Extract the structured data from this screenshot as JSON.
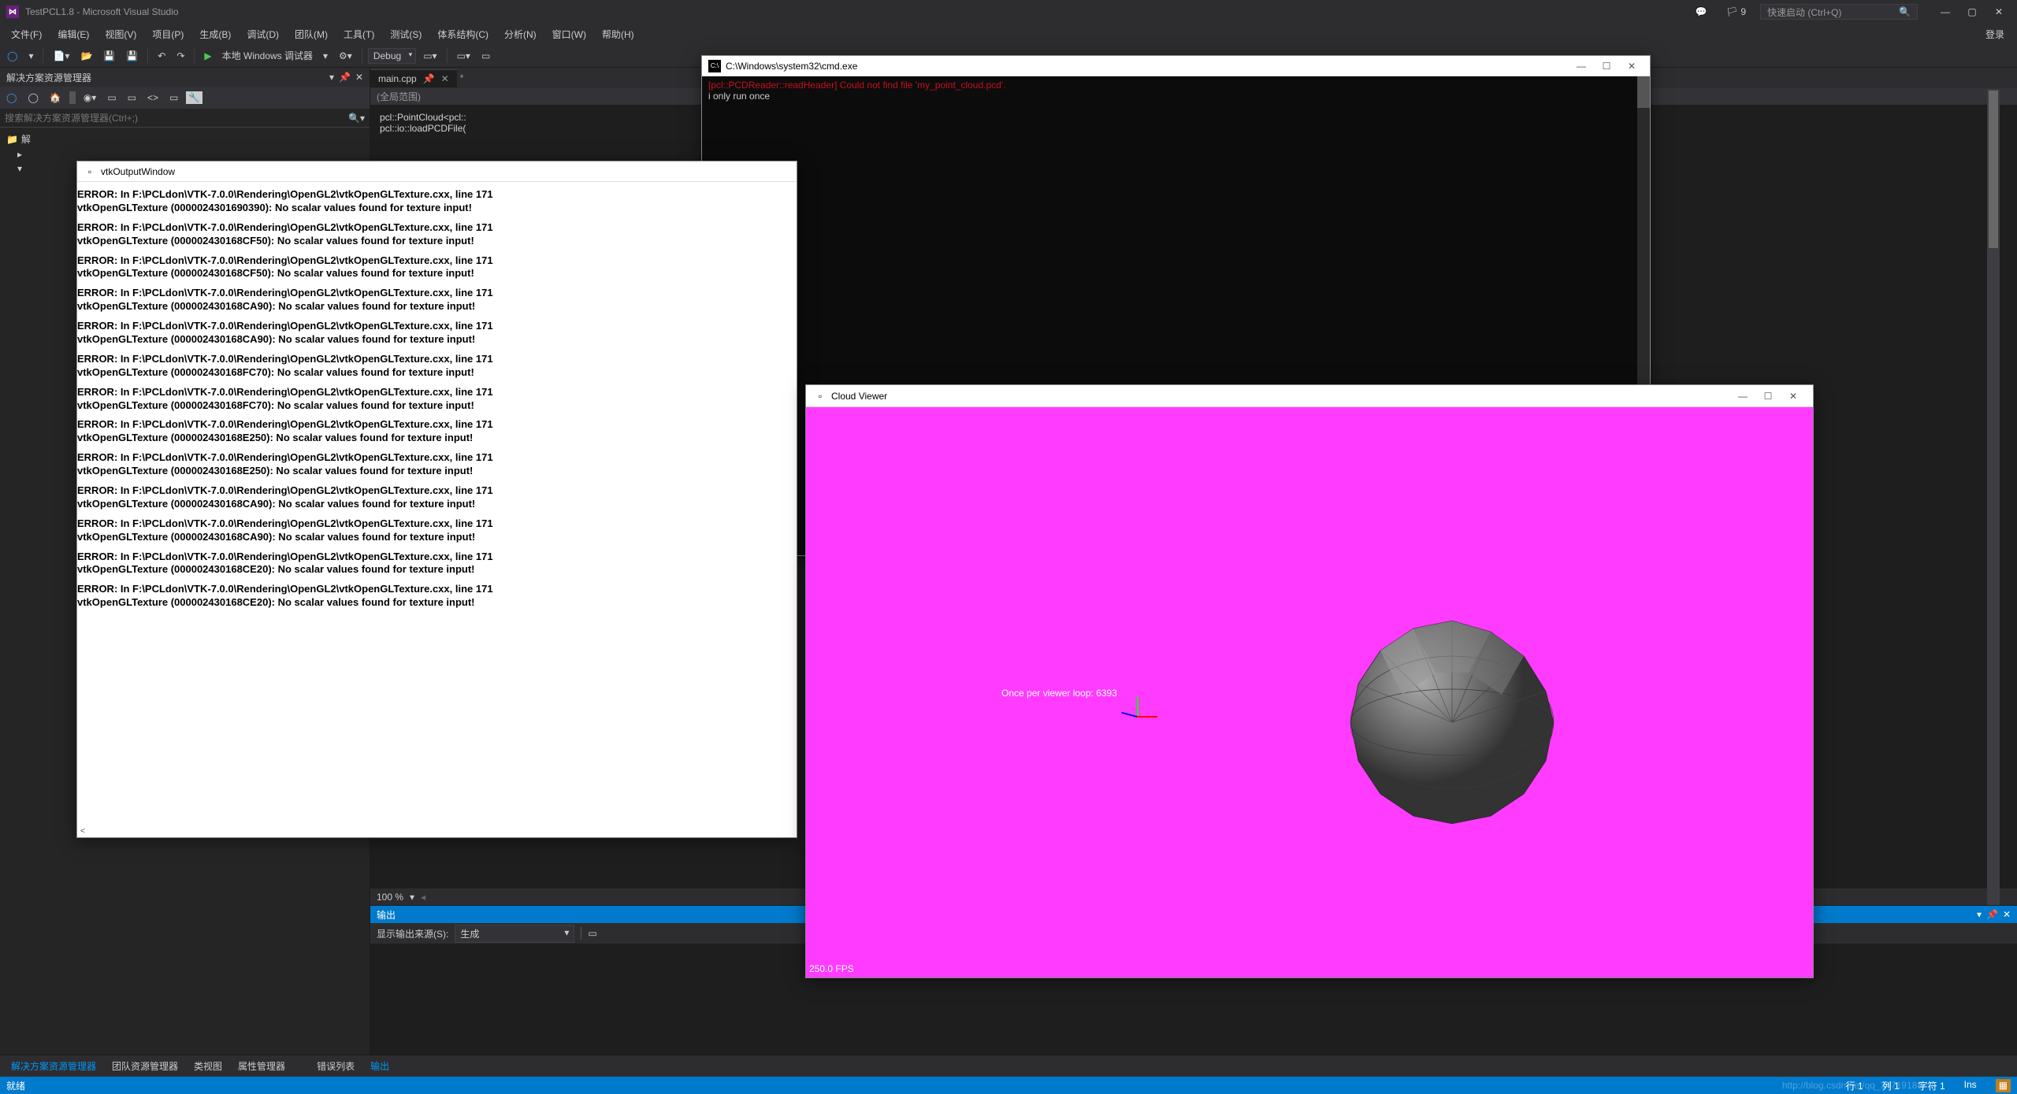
{
  "titlebar": {
    "title": "TestPCL1.8 - Microsoft Visual Studio",
    "notif_count": "9",
    "quick_launch_placeholder": "快速启动 (Ctrl+Q)"
  },
  "menu": {
    "file": "文件(F)",
    "edit": "编辑(E)",
    "view": "视图(V)",
    "project": "项目(P)",
    "build": "生成(B)",
    "debug": "调试(D)",
    "team": "团队(M)",
    "tools": "工具(T)",
    "test": "测试(S)",
    "arch": "体系结构(C)",
    "analyze": "分析(N)",
    "window": "窗口(W)",
    "help": "帮助(H)",
    "login": "登录"
  },
  "toolbar": {
    "debugger_label": "本地 Windows 调试器",
    "config": "Debug"
  },
  "solution_panel": {
    "title": "解决方案资源管理器",
    "search_placeholder": "搜索解决方案资源管理器(Ctrl+;)",
    "tree_items": [
      "解"
    ]
  },
  "editor": {
    "tab_name": "main.cpp",
    "scope": "(全局范围)",
    "code_line1": "pcl::PointCloud<pcl::",
    "code_line2": "pcl::io::loadPCDFile(",
    "zoom": "100 %"
  },
  "output": {
    "title": "输出",
    "source_label": "显示输出来源(S):",
    "source_value": "生成"
  },
  "bottom_tabs": {
    "solution": "解决方案资源管理器",
    "team": "团队资源管理器",
    "class": "类视图",
    "property": "属性管理器",
    "error_list": "错误列表",
    "output": "输出"
  },
  "statusbar": {
    "ready": "就绪",
    "line": "行 1",
    "col": "列 1",
    "char": "字符 1",
    "ins": "Ins",
    "watermark": "http://blog.csdn.net/qq_34719188"
  },
  "vtk_window": {
    "title": "vtkOutputWindow",
    "errors": [
      {
        "l1": "ERROR: In F:\\PCLdon\\VTK-7.0.0\\Rendering\\OpenGL2\\vtkOpenGLTexture.cxx, line 171",
        "l2": "vtkOpenGLTexture (0000024301690390): No scalar values found for texture input!"
      },
      {
        "l1": "ERROR: In F:\\PCLdon\\VTK-7.0.0\\Rendering\\OpenGL2\\vtkOpenGLTexture.cxx, line 171",
        "l2": "vtkOpenGLTexture (000002430168CF50): No scalar values found for texture input!"
      },
      {
        "l1": "ERROR: In F:\\PCLdon\\VTK-7.0.0\\Rendering\\OpenGL2\\vtkOpenGLTexture.cxx, line 171",
        "l2": "vtkOpenGLTexture (000002430168CF50): No scalar values found for texture input!"
      },
      {
        "l1": "ERROR: In F:\\PCLdon\\VTK-7.0.0\\Rendering\\OpenGL2\\vtkOpenGLTexture.cxx, line 171",
        "l2": "vtkOpenGLTexture (000002430168CA90): No scalar values found for texture input!"
      },
      {
        "l1": "ERROR: In F:\\PCLdon\\VTK-7.0.0\\Rendering\\OpenGL2\\vtkOpenGLTexture.cxx, line 171",
        "l2": "vtkOpenGLTexture (000002430168CA90): No scalar values found for texture input!"
      },
      {
        "l1": "ERROR: In F:\\PCLdon\\VTK-7.0.0\\Rendering\\OpenGL2\\vtkOpenGLTexture.cxx, line 171",
        "l2": "vtkOpenGLTexture (000002430168FC70): No scalar values found for texture input!"
      },
      {
        "l1": "ERROR: In F:\\PCLdon\\VTK-7.0.0\\Rendering\\OpenGL2\\vtkOpenGLTexture.cxx, line 171",
        "l2": "vtkOpenGLTexture (000002430168FC70): No scalar values found for texture input!"
      },
      {
        "l1": "ERROR: In F:\\PCLdon\\VTK-7.0.0\\Rendering\\OpenGL2\\vtkOpenGLTexture.cxx, line 171",
        "l2": "vtkOpenGLTexture (000002430168E250): No scalar values found for texture input!"
      },
      {
        "l1": "ERROR: In F:\\PCLdon\\VTK-7.0.0\\Rendering\\OpenGL2\\vtkOpenGLTexture.cxx, line 171",
        "l2": "vtkOpenGLTexture (000002430168E250): No scalar values found for texture input!"
      },
      {
        "l1": "ERROR: In F:\\PCLdon\\VTK-7.0.0\\Rendering\\OpenGL2\\vtkOpenGLTexture.cxx, line 171",
        "l2": "vtkOpenGLTexture (000002430168CA90): No scalar values found for texture input!"
      },
      {
        "l1": "ERROR: In F:\\PCLdon\\VTK-7.0.0\\Rendering\\OpenGL2\\vtkOpenGLTexture.cxx, line 171",
        "l2": "vtkOpenGLTexture (000002430168CA90): No scalar values found for texture input!"
      },
      {
        "l1": "ERROR: In F:\\PCLdon\\VTK-7.0.0\\Rendering\\OpenGL2\\vtkOpenGLTexture.cxx, line 171",
        "l2": "vtkOpenGLTexture (000002430168CE20): No scalar values found for texture input!"
      },
      {
        "l1": "ERROR: In F:\\PCLdon\\VTK-7.0.0\\Rendering\\OpenGL2\\vtkOpenGLTexture.cxx, line 171",
        "l2": "vtkOpenGLTexture (000002430168CE20): No scalar values found for texture input!"
      }
    ]
  },
  "cmd_window": {
    "title": "C:\\Windows\\system32\\cmd.exe",
    "line1": "[pcl::PCDReader::readHeader] Could not find file 'my_point_cloud.pcd'.",
    "line2": "i only run once"
  },
  "cloud_window": {
    "title": "Cloud Viewer",
    "loop_text": "Once per viewer loop: ",
    "loop_count": "6393",
    "fps": "250.0 FPS"
  }
}
